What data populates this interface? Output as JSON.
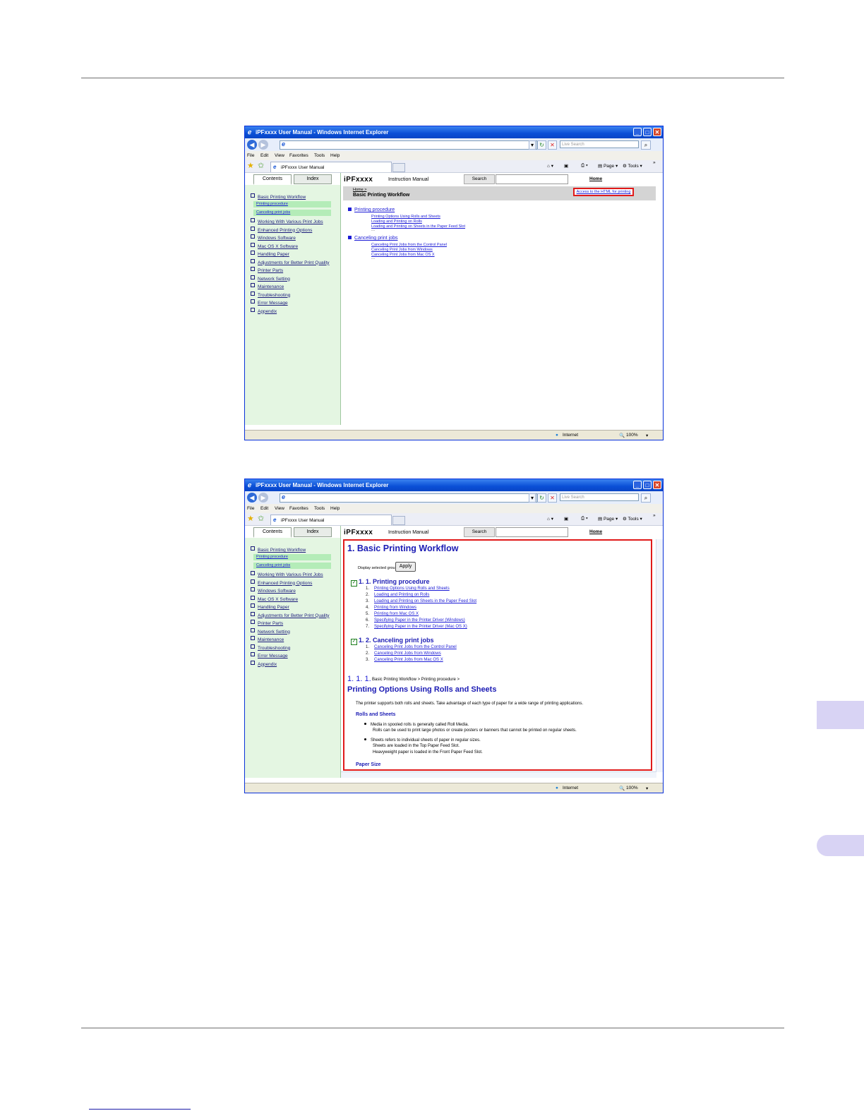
{
  "page": {
    "side_tab_color": "#d8d3f4",
    "rule_color": "#6e6e6e"
  },
  "browser": {
    "window_title": "iPFxxxx User Manual - Windows Internet Explorer",
    "live_search_placeholder": "Live Search",
    "menu": [
      "File",
      "Edit",
      "View",
      "Favorites",
      "Tools",
      "Help"
    ],
    "tab_title": "iPFxxxx User Manual",
    "command_bar": {
      "page": "Page",
      "tools": "Tools"
    },
    "status": {
      "zone": "Internet",
      "zoom": "100%"
    }
  },
  "manual": {
    "tabs": {
      "contents": "Contents",
      "index": "Index"
    },
    "brand": "iPFxxxx",
    "instruction_manual": "Instruction Manual",
    "search_button": "Search",
    "home_link": "Home",
    "toc": {
      "first": "Basic Printing Workflow",
      "subs": [
        "Printing procedure",
        "Canceling print jobs"
      ],
      "rest": [
        "Working With Various Print Jobs",
        "Enhanced Printing Options",
        "Windows Software",
        "Mac OS X Software",
        "Handling Paper",
        "Adjustments for Better Print Quality",
        "Printer Parts",
        "Network Setting",
        "Maintenance",
        "Troubleshooting",
        "Error Message",
        "Appendix"
      ]
    }
  },
  "window1": {
    "crumb": "Home >",
    "heading": "Basic Printing Workflow",
    "access_button": "Access to the HTML for printing",
    "sections": [
      {
        "title": "Printing procedure",
        "links": [
          "Printing Options Using Rolls and Sheets",
          "Loading and Printing on Rolls",
          "Loading and Printing on Sheets in the Paper Feed Slot"
        ],
        "more": "..."
      },
      {
        "title": "Canceling print jobs",
        "links": [
          "Canceling Print Jobs from the Control Panel",
          "Canceling Print Jobs from Windows",
          "Canceling Print Jobs from Mac OS X"
        ],
        "more": "..."
      }
    ]
  },
  "window2": {
    "title": "1. Basic Printing Workflow",
    "display_selected_groups": "Display selected groups",
    "apply": "Apply",
    "check_mark": "✓",
    "group1": {
      "title": "1. 1. Printing procedure",
      "items": [
        {
          "n": "1.",
          "t": "Printing Options Using Rolls and Sheets"
        },
        {
          "n": "2.",
          "t": "Loading and Printing on Rolls"
        },
        {
          "n": "3.",
          "t": "Loading and Printing on Sheets in the Paper Feed Slot"
        },
        {
          "n": "4.",
          "t": "Printing from Windows"
        },
        {
          "n": "5.",
          "t": "Printing from Mac OS X"
        },
        {
          "n": "6.",
          "t": "Specifying Paper in the Printer Driver (Windows)"
        },
        {
          "n": "7.",
          "t": "Specifying Paper in the Printer Driver (Mac OS X)"
        }
      ]
    },
    "group2": {
      "title": "1. 2. Canceling print jobs",
      "items": [
        {
          "n": "1.",
          "t": "Canceling Print Jobs from the Control Panel"
        },
        {
          "n": "2.",
          "t": "Canceling Print Jobs from Windows"
        },
        {
          "n": "3.",
          "t": "Canceling Print Jobs from Mac OS X"
        }
      ]
    },
    "section_number": "1. 1. 1.",
    "section_crumbs": "Basic Printing Workflow > Printing procedure >",
    "section_title": "Printing Options Using Rolls and Sheets",
    "intro": "The printer supports both rolls and sheets. Take advantage of each type of paper for a wide range of printing applications.",
    "rolls_heading": "Rolls and Sheets",
    "bullet1": "Media in spooled rolls is generally called Roll Media.",
    "bullet1_cont": "Rolls can be used to print large photos or create posters or banners that cannot be printed on regular sheets.",
    "bullet2": "Sheets refers to individual sheets of paper in regular sizes.",
    "bullet2_cont1": "Sheets are loaded in the Top Paper Feed Slot.",
    "bullet2_cont2": "Heavyweight paper is loaded in the Front Paper Feed Slot.",
    "paper_size_heading": "Paper Size"
  }
}
